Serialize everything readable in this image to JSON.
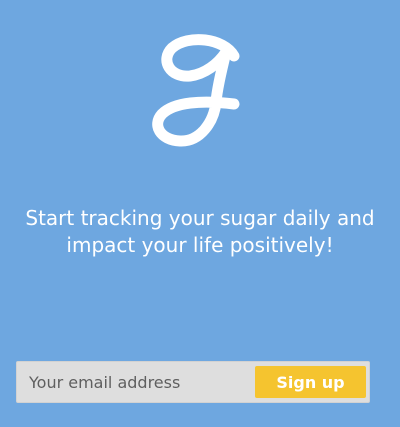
{
  "app": {
    "logo_icon": "script-g-logo-icon"
  },
  "hero": {
    "tagline_line1": "Start tracking your sugar daily and",
    "tagline_line2": "impact your life positively!"
  },
  "signup": {
    "email_placeholder": "Your email address",
    "email_value": "",
    "button_label": "Sign up"
  },
  "colors": {
    "background": "#6ea7e0",
    "button": "#f5c42f",
    "input_background": "#dedede",
    "text": "#ffffff"
  }
}
